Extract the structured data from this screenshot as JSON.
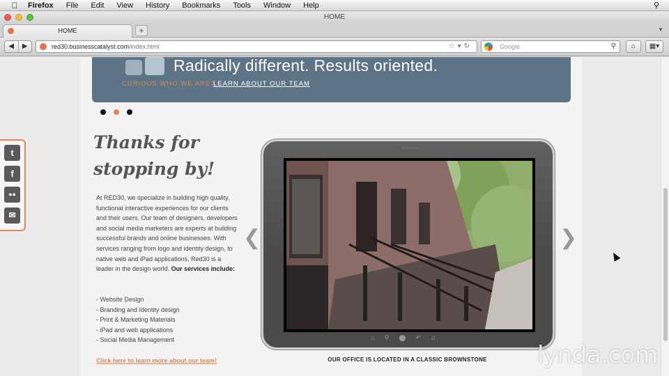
{
  "menubar": {
    "app": "Firefox",
    "items": [
      "File",
      "Edit",
      "View",
      "History",
      "Bookmarks",
      "Tools",
      "Window",
      "Help"
    ]
  },
  "window": {
    "title": "HOME"
  },
  "tab": {
    "label": "HOME",
    "new_tab": "+"
  },
  "url": {
    "domain": "red30.businesscatalyst.com",
    "path": "/index.html"
  },
  "search": {
    "placeholder": "Google"
  },
  "banner": {
    "headline": "Radically different. Results oriented.",
    "curious": "CURIOUS WHO WE ARE?",
    "learn_link": "LEARN ABOUT OUR TEAM"
  },
  "heading": {
    "line1": "Thanks for",
    "line2": "stopping by!"
  },
  "intro": {
    "text": "At RED30, we specialize in building high quality, functional interactive experiences for our clients and their users.  Our team of designers, developers and social media marketers are experts at building successful brands and online businesses.  With services ranging from logo and identity design, to native web and iPad applications, Red30 is a leader in the design world. ",
    "bold": "Our services include:"
  },
  "services": [
    "- Website Design",
    "- Branding and Identity design",
    "- Print & Marketing Materials",
    "- iPad and web applications",
    "- Social Media Management"
  ],
  "team_link": "Click here to learn more about our team!",
  "caption": "OUR OFFICE IS LOCATED IN A CLASSIC BROWNSTONE",
  "social": [
    "twitter-icon",
    "facebook-icon",
    "flickr-icon",
    "mail-icon"
  ],
  "slider": {
    "total": 3,
    "active": 2
  },
  "watermark": "lynda.com",
  "colors": {
    "accent": "#e0865a",
    "banner": "#5d7486"
  }
}
